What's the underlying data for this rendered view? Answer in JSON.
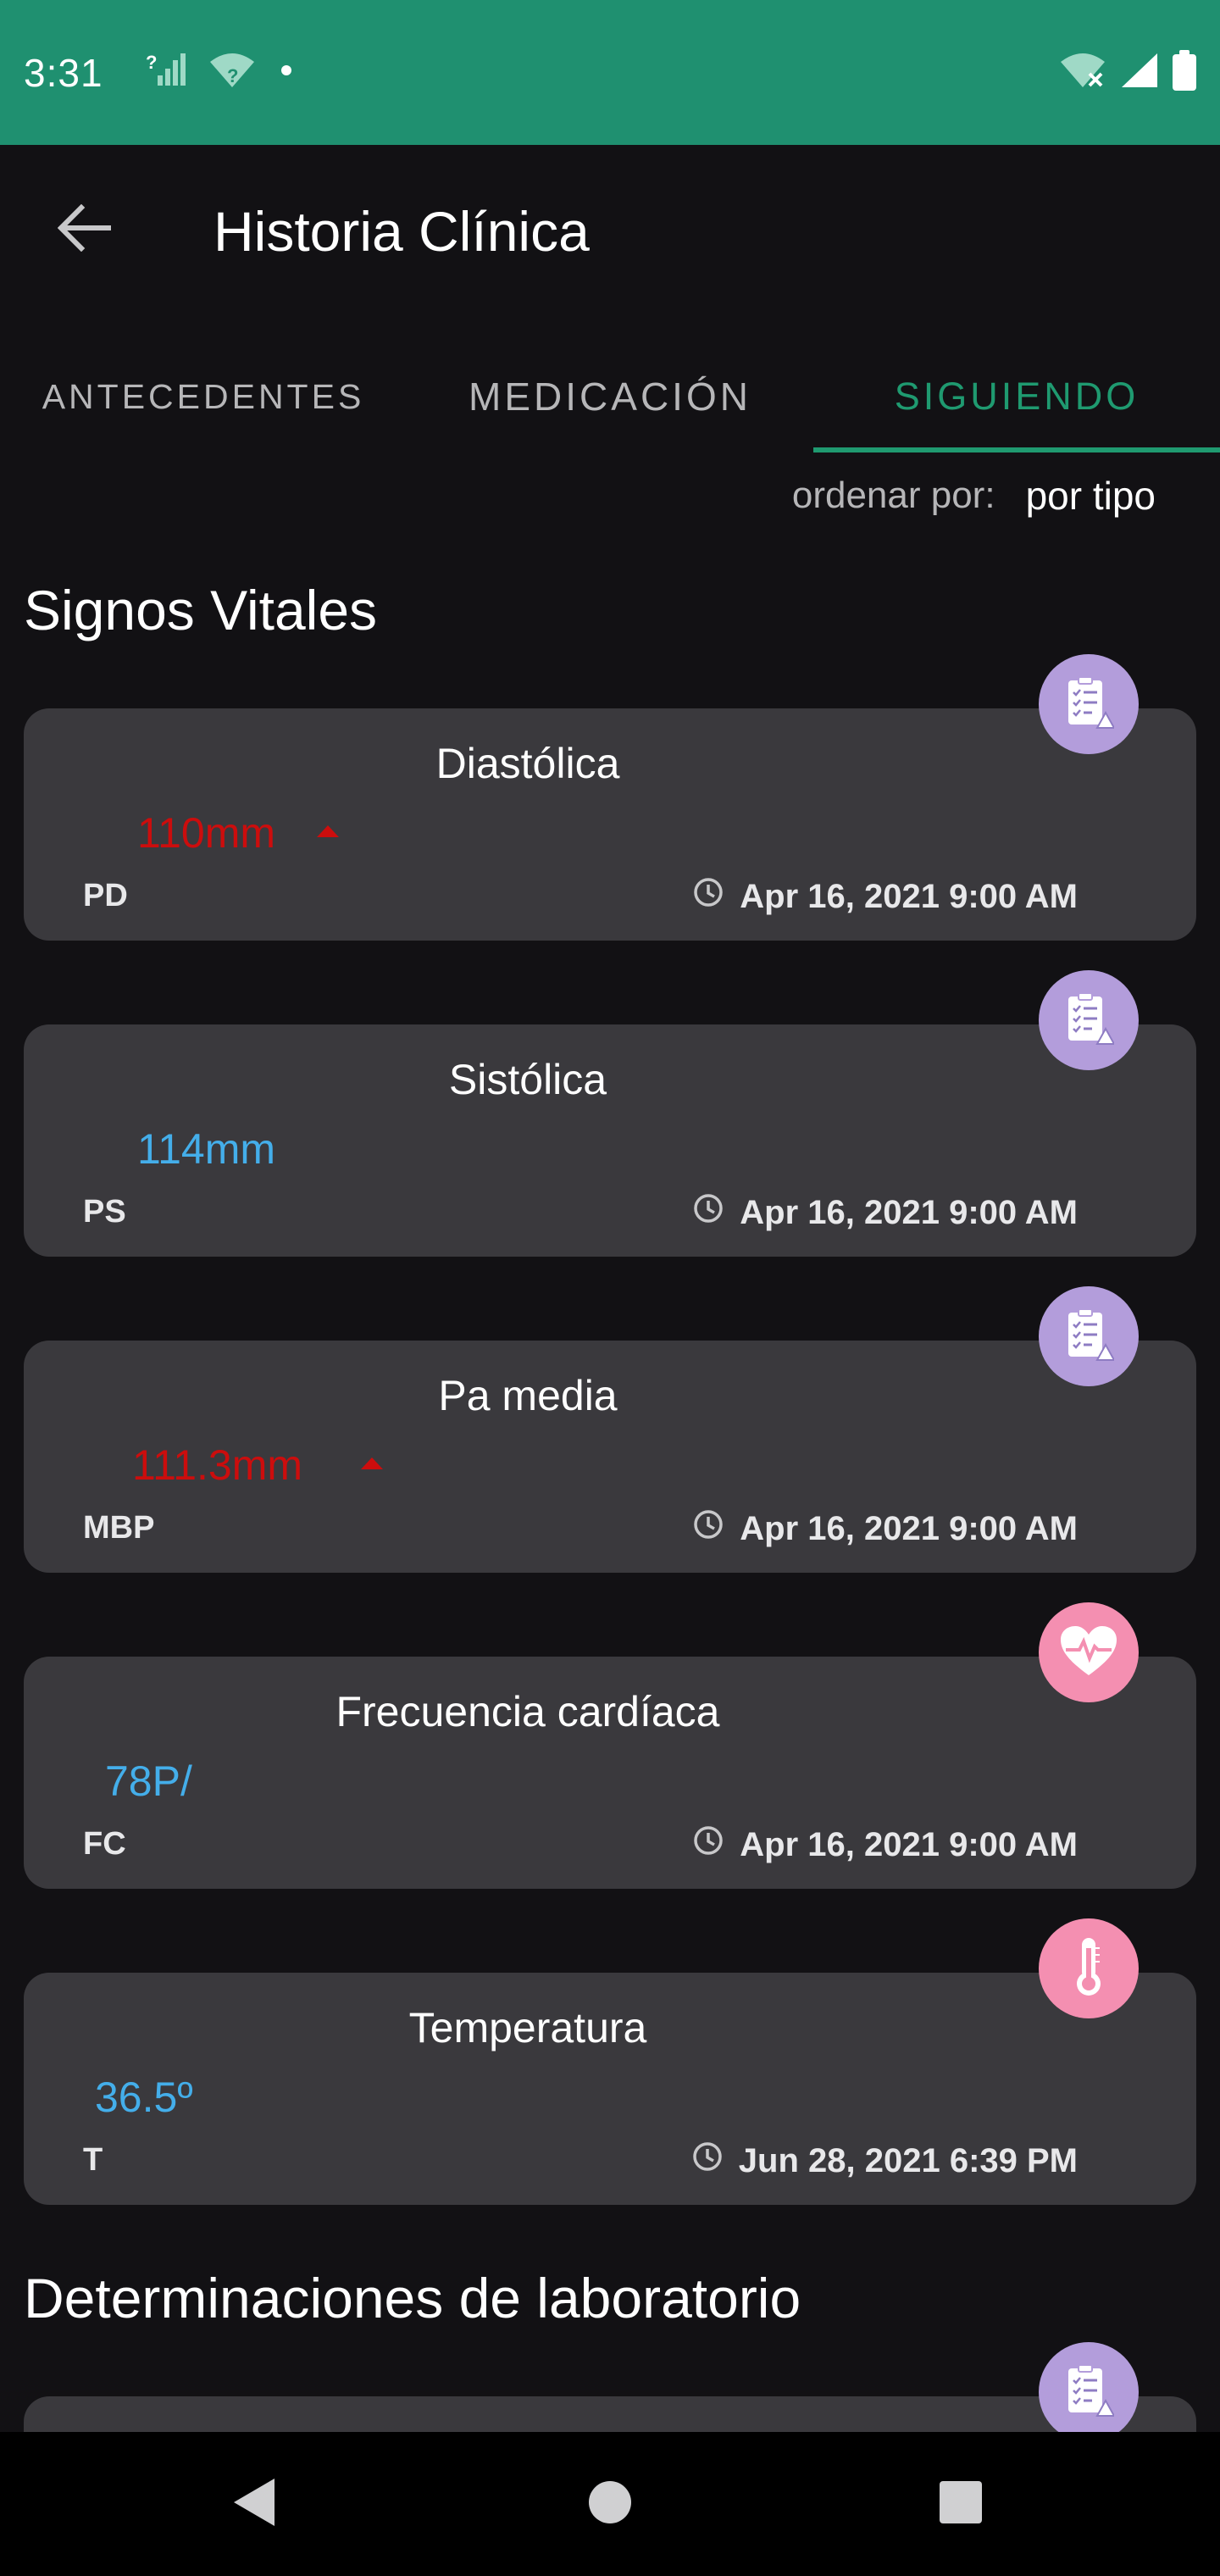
{
  "status_bar": {
    "time": "3:31",
    "background": "#1f9070",
    "icons": [
      "signal-unknown-icon",
      "wifi-unknown-icon",
      "notification-dot-icon",
      "wifi-off-icon",
      "cell-signal-icon",
      "battery-icon"
    ]
  },
  "app_bar": {
    "title": "Historia Clínica",
    "back_icon": "arrow-back-icon"
  },
  "tabs": [
    {
      "label": "ANTECEDENTES",
      "selected": false
    },
    {
      "label": "MEDICACIÓN",
      "selected": false
    },
    {
      "label": "SIGUIENDO",
      "selected": true
    }
  ],
  "accent_color": "#1f9a70",
  "sort": {
    "label": "ordenar por:",
    "value": "por tipo"
  },
  "sections": {
    "vitals_title": "Signos Vitales",
    "lab_title": "Determinaciones de laboratorio"
  },
  "cards": [
    {
      "title": "Diastólica",
      "value": "110mm",
      "status": "high",
      "trend": "up",
      "code": "PD",
      "time": "Apr 16, 2021 9:00 AM",
      "icon": "clipboard-checklist-icon",
      "icon_color": "#b39ddb"
    },
    {
      "title": "Sistólica",
      "value": "114mm",
      "status": "normal",
      "trend": "",
      "code": "PS",
      "time": "Apr 16, 2021 9:00 AM",
      "icon": "clipboard-checklist-icon",
      "icon_color": "#b39ddb"
    },
    {
      "title": "Pa media",
      "value": "111.3mm",
      "status": "high",
      "trend": "up",
      "code": "MBP",
      "time": "Apr 16, 2021 9:00 AM",
      "icon": "clipboard-checklist-icon",
      "icon_color": "#b39ddb"
    },
    {
      "title": "Frecuencia cardíaca",
      "value": "78P/",
      "status": "normal",
      "trend": "",
      "code": "FC",
      "time": "Apr 16, 2021 9:00 AM",
      "icon": "heart-pulse-icon",
      "icon_color": "#f48fb1"
    },
    {
      "title": "Temperatura",
      "value": "36.5º",
      "status": "normal",
      "trend": "",
      "code": "T",
      "time": "Jun 28, 2021 6:39 PM",
      "icon": "thermometer-icon",
      "icon_color": "#f48fb1"
    }
  ],
  "colors": {
    "high": "#cc0d0d",
    "normal": "#44aeea",
    "card_bg": "#3a393d",
    "page_bg": "#121114"
  },
  "nav_bar": {
    "icons": [
      "nav-back-icon",
      "nav-home-icon",
      "nav-recents-icon"
    ]
  }
}
